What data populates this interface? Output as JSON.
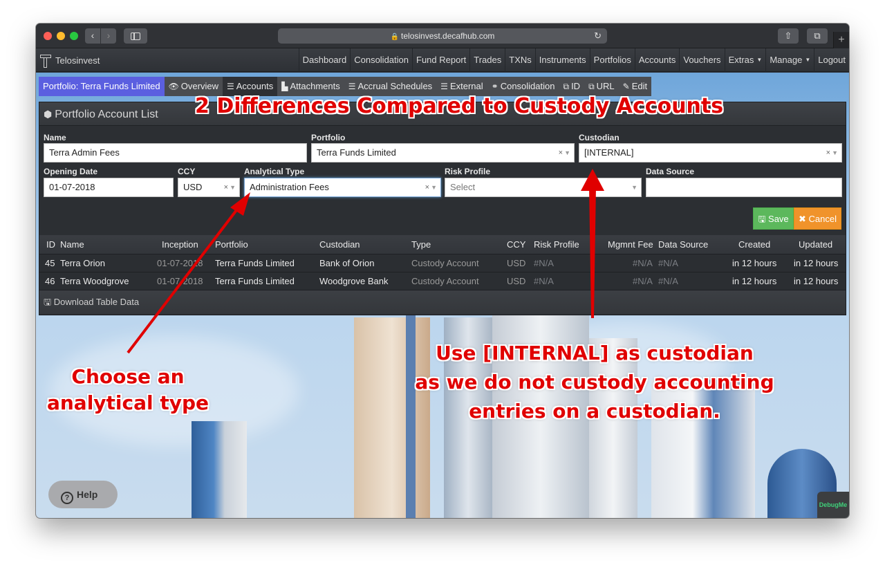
{
  "browser": {
    "url": "telosinvest.decafhub.com",
    "back_icon": "chevron-left",
    "forward_icon": "chevron-right",
    "reload_icon": "reload",
    "new_tab_label": "+"
  },
  "navbar": {
    "brand": "Telosinvest",
    "links": [
      {
        "label": "Dashboard"
      },
      {
        "label": "Consolidation"
      },
      {
        "label": "Fund Report"
      },
      {
        "label": "Trades"
      },
      {
        "label": "TXNs"
      },
      {
        "label": "Instruments"
      },
      {
        "label": "Portfolios"
      },
      {
        "label": "Accounts"
      },
      {
        "label": "Vouchers"
      },
      {
        "label": "Extras",
        "dropdown": true
      },
      {
        "label": "Manage",
        "dropdown": true
      },
      {
        "label": "Logout"
      }
    ]
  },
  "portfolio_tabs": {
    "title": "Portfolio: Terra Funds Limited",
    "tabs": [
      {
        "label": "Overview",
        "icon": "eye"
      },
      {
        "label": "Accounts",
        "icon": "list",
        "active": true
      },
      {
        "label": "Attachments",
        "icon": "file"
      },
      {
        "label": "Accrual Schedules",
        "icon": "list"
      },
      {
        "label": "External",
        "icon": "list"
      },
      {
        "label": "Consolidation",
        "icon": "link"
      },
      {
        "label": "ID",
        "icon": "copy"
      },
      {
        "label": "URL",
        "icon": "copy"
      },
      {
        "label": "Edit",
        "icon": "edit"
      }
    ]
  },
  "panel": {
    "title": "Portfolio Account List",
    "form": {
      "name": {
        "label": "Name",
        "value": "Terra Admin Fees"
      },
      "portfolio": {
        "label": "Portfolio",
        "value": "Terra Funds Limited"
      },
      "custodian": {
        "label": "Custodian",
        "value": "[INTERNAL]"
      },
      "opening_date": {
        "label": "Opening Date",
        "value": "01-07-2018"
      },
      "ccy": {
        "label": "CCY",
        "value": "USD"
      },
      "analytical_type": {
        "label": "Analytical Type",
        "value": "Administration Fees"
      },
      "risk_profile": {
        "label": "Risk Profile",
        "placeholder": "Select"
      },
      "data_source": {
        "label": "Data Source",
        "value": ""
      },
      "clear_symbol": "×",
      "arrow_symbol": "▼"
    },
    "buttons": {
      "save": "Save",
      "cancel": "Cancel"
    },
    "table": {
      "columns": [
        "ID",
        "Name",
        "Inception",
        "Portfolio",
        "Custodian",
        "Type",
        "CCY",
        "Risk Profile",
        "Mgmnt Fee",
        "Data Source",
        "Created",
        "Updated"
      ],
      "rows": [
        {
          "id": "45",
          "name": "Terra Orion",
          "inception": "01-07-2018",
          "portfolio": "Terra Funds Limited",
          "custodian": "Bank of Orion",
          "type": "Custody Account",
          "ccy": "USD",
          "risk_profile": "#N/A",
          "mgmnt_fee": "#N/A",
          "data_source": "#N/A",
          "created": "in 12 hours",
          "updated": "in 12 hours"
        },
        {
          "id": "46",
          "name": "Terra Woodgrove",
          "inception": "01-07-2018",
          "portfolio": "Terra Funds Limited",
          "custodian": "Woodgrove Bank",
          "type": "Custody Account",
          "ccy": "USD",
          "risk_profile": "#N/A",
          "mgmnt_fee": "#N/A",
          "data_source": "#N/A",
          "created": "in 12 hours",
          "updated": "in 12 hours"
        }
      ],
      "download_label": "Download Table Data"
    }
  },
  "help": {
    "label": "Help"
  },
  "debugme": {
    "label": "DebugMe"
  },
  "annotations": {
    "title": "2 Differences Compared to Custody Accounts",
    "left": [
      "Choose an",
      "analytical type"
    ],
    "right": [
      "Use [INTERNAL] as custodian",
      "as we do not custody accounting",
      "entries on a custodian."
    ],
    "color": "#e00000"
  }
}
